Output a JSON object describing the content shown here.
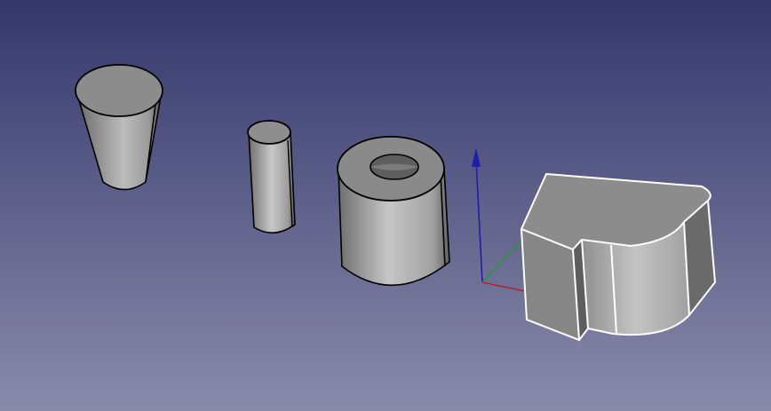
{
  "viewport": {
    "background_top": "#35376b",
    "background_bottom": "#8a8aaa",
    "selection_color": "#ffffff"
  },
  "axes": {
    "x_color": "#c0141e",
    "y_color": "#1e9a2a",
    "z_color": "#1e1eaa"
  },
  "objects": [
    {
      "name": "truncated-cone",
      "selected": false
    },
    {
      "name": "cylinder",
      "selected": false
    },
    {
      "name": "tube",
      "selected": false
    },
    {
      "name": "extruded-solid",
      "selected": true
    }
  ]
}
